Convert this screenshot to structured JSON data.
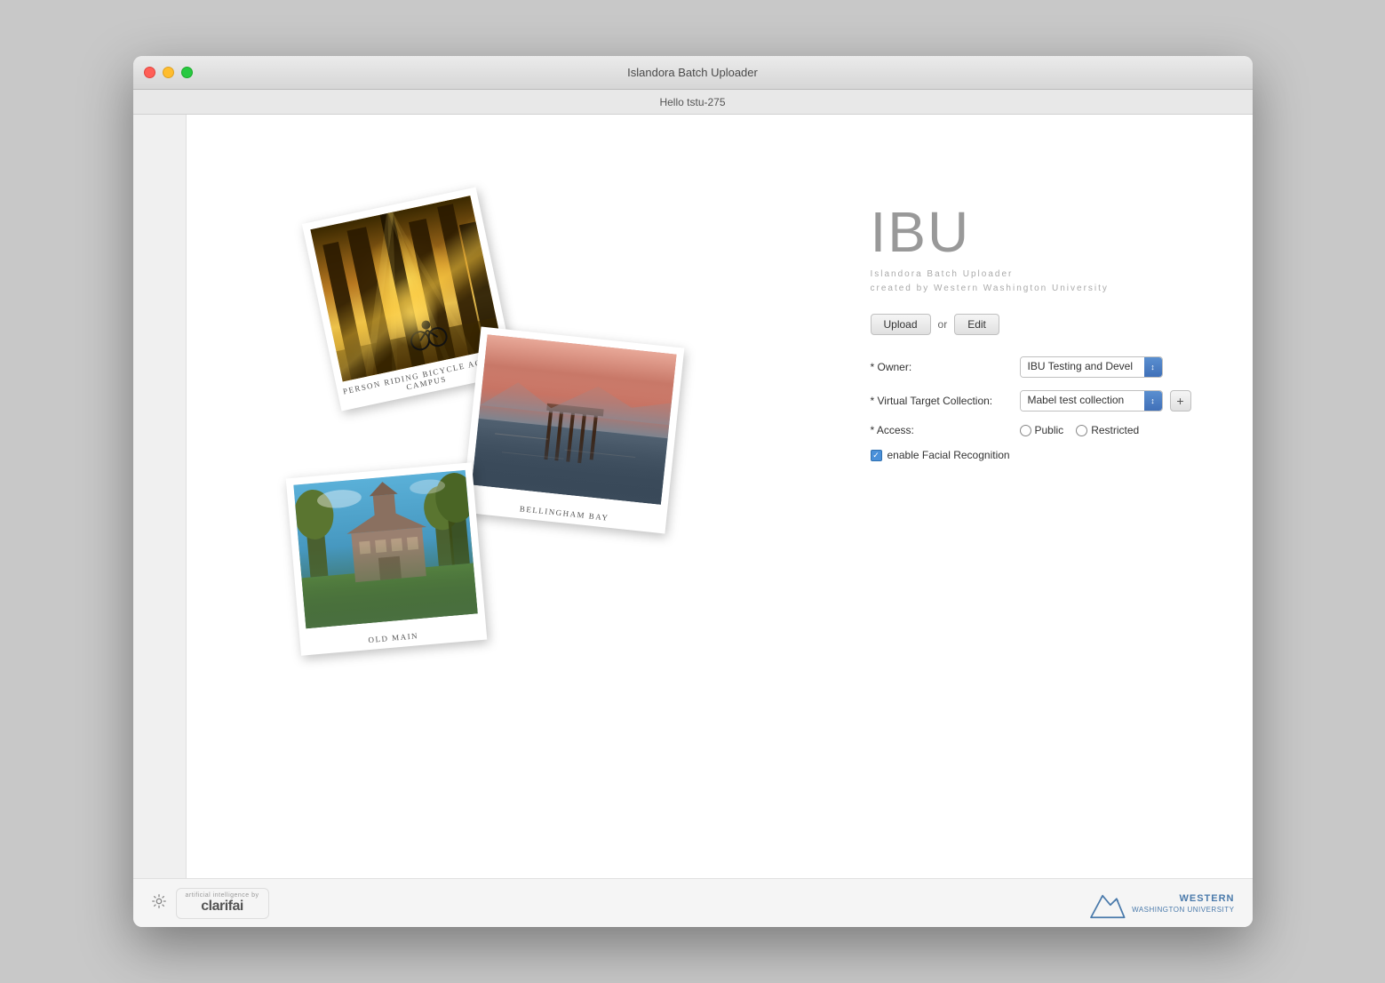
{
  "window": {
    "title": "Islandora Batch Uploader"
  },
  "subbar": {
    "text": "Hello tstu-275"
  },
  "ibu": {
    "logo": "IBU",
    "tagline_line1": "Islandora Batch Uploader",
    "tagline_line2": "created by Western Washington University"
  },
  "actions": {
    "upload_label": "Upload",
    "or_text": "or",
    "edit_label": "Edit"
  },
  "form": {
    "owner_label": "* Owner:",
    "owner_value": "IBU Testing and Devel",
    "virtual_target_label": "* Virtual Target Collection:",
    "virtual_target_value": "Mabel test collection",
    "access_label": "* Access:",
    "access_public": "Public",
    "access_restricted": "Restricted",
    "facial_recognition_label": "enable Facial Recognition"
  },
  "photos": [
    {
      "caption": "Person Riding Bicycle Across Campus",
      "type": "bicycle"
    },
    {
      "caption": "Bellingham Bay",
      "type": "bay"
    },
    {
      "caption": "Old Main",
      "type": "building"
    }
  ],
  "footer": {
    "clarifai_small": "artificial intelligence by",
    "clarifai_logo": "clarifai",
    "western_text": "WESTERN",
    "western_sub": "WASHINGTON UNIVERSITY"
  }
}
